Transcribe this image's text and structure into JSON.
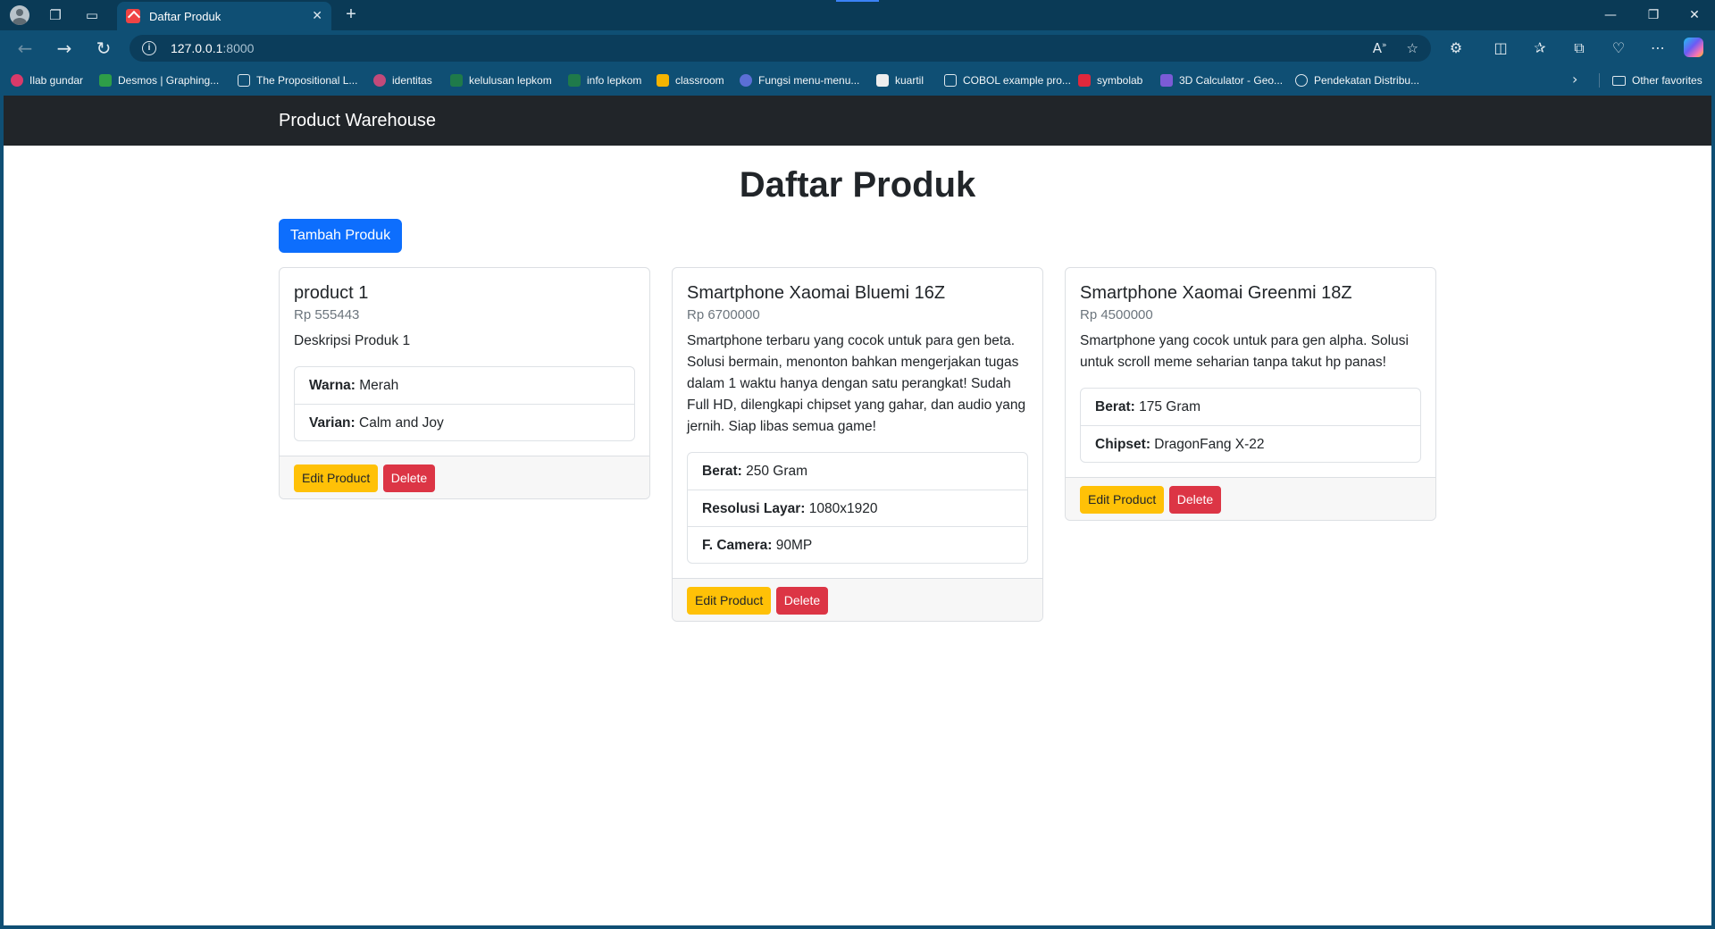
{
  "browser": {
    "tab_title": "Daftar Produk",
    "url_host": "127.0.0.1",
    "url_port": ":8000",
    "favorites": [
      {
        "label": "Ilab gundar",
        "color": "#d93a6a"
      },
      {
        "label": "Desmos | Graphing...",
        "color": "#2e9e48"
      },
      {
        "label": "The Propositional L...",
        "color": "#dfe8ee"
      },
      {
        "label": "identitas",
        "color": "#c24a7a"
      },
      {
        "label": "kelulusan lepkom",
        "color": "#1f7a4a"
      },
      {
        "label": "info lepkom",
        "color": "#1f7a4a"
      },
      {
        "label": "classroom",
        "color": "#f5b400"
      },
      {
        "label": "Fungsi menu-menu...",
        "color": "#5b6fd6"
      },
      {
        "label": "kuartil",
        "color": "#eeeeee"
      },
      {
        "label": "COBOL example pro...",
        "color": "#dfe8ee"
      },
      {
        "label": "symbolab",
        "color": "#e0283c"
      },
      {
        "label": "3D Calculator - Geo...",
        "color": "#7b5bd6"
      },
      {
        "label": "Pendekatan Distribu...",
        "color": "#dfe8ee"
      }
    ],
    "other_favorites": "Other favorites"
  },
  "app": {
    "brand": "Product Warehouse",
    "page_title": "Daftar Produk",
    "add_button": "Tambah Produk",
    "edit_label": "Edit Product",
    "delete_label": "Delete"
  },
  "products": [
    {
      "name": "product 1",
      "price": "Rp 555443",
      "description": "Deskripsi Produk 1",
      "specs": [
        {
          "label": "Warna:",
          "value": " Merah"
        },
        {
          "label": "Varian:",
          "value": " Calm and Joy"
        }
      ]
    },
    {
      "name": "Smartphone Xaomai Bluemi 16Z",
      "price": "Rp 6700000",
      "description": "Smartphone terbaru yang cocok untuk para gen beta. Solusi bermain, menonton bahkan mengerjakan tugas dalam 1 waktu hanya dengan satu perangkat! Sudah Full HD, dilengkapi chipset yang gahar, dan audio yang jernih. Siap libas semua game!",
      "specs": [
        {
          "label": "Berat:",
          "value": " 250 Gram"
        },
        {
          "label": "Resolusi Layar:",
          "value": " 1080x1920"
        },
        {
          "label": "F. Camera:",
          "value": " 90MP"
        }
      ]
    },
    {
      "name": "Smartphone Xaomai Greenmi 18Z",
      "price": "Rp 4500000",
      "description": "Smartphone yang cocok untuk para gen alpha. Solusi untuk scroll meme seharian tanpa takut hp panas!",
      "specs": [
        {
          "label": "Berat:",
          "value": " 175 Gram"
        },
        {
          "label": "Chipset:",
          "value": " DragonFang X-22"
        }
      ]
    }
  ],
  "icons": {
    "profile": "profile-icon",
    "workspaces": "workspaces-icon",
    "tab_actions": "tab-actions-icon",
    "back": "back-arrow-icon",
    "forward": "forward-arrow-icon",
    "refresh": "refresh-icon",
    "site_info": "info-icon",
    "read_aloud": "read-aloud-icon",
    "favorite": "star-icon",
    "extensions": "extensions-icon",
    "split": "split-screen-icon",
    "favorites": "favorites-icon",
    "collections": "collections-icon",
    "performance": "performance-icon",
    "more": "more-icon",
    "copilot": "copilot-icon"
  },
  "colors": {
    "primary": "#0d6efd",
    "warning": "#ffc107",
    "danger": "#dc3545",
    "navbar": "#212529",
    "browser_frame": "#0f4f74"
  }
}
